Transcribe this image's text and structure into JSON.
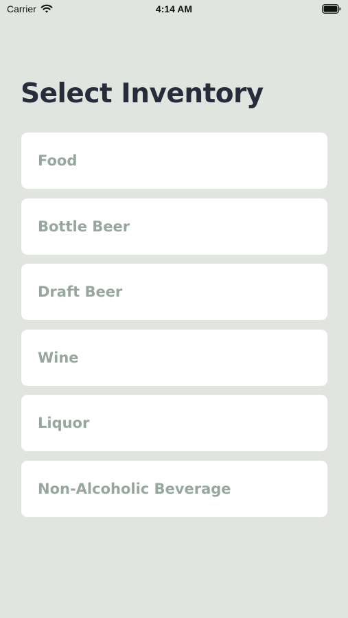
{
  "status_bar": {
    "carrier": "Carrier",
    "time": "4:14 AM",
    "wifi_icon": "wifi-icon",
    "battery_icon": "battery-icon"
  },
  "page": {
    "title": "Select Inventory"
  },
  "inventory": {
    "items": [
      {
        "label": "Food"
      },
      {
        "label": "Bottle Beer"
      },
      {
        "label": "Draft Beer"
      },
      {
        "label": "Wine"
      },
      {
        "label": "Liquor"
      },
      {
        "label": "Non-Alcoholic Beverage"
      }
    ]
  },
  "colors": {
    "background": "#e1e5df",
    "card": "#ffffff",
    "title": "#262c39",
    "item_text": "#98a79d"
  }
}
